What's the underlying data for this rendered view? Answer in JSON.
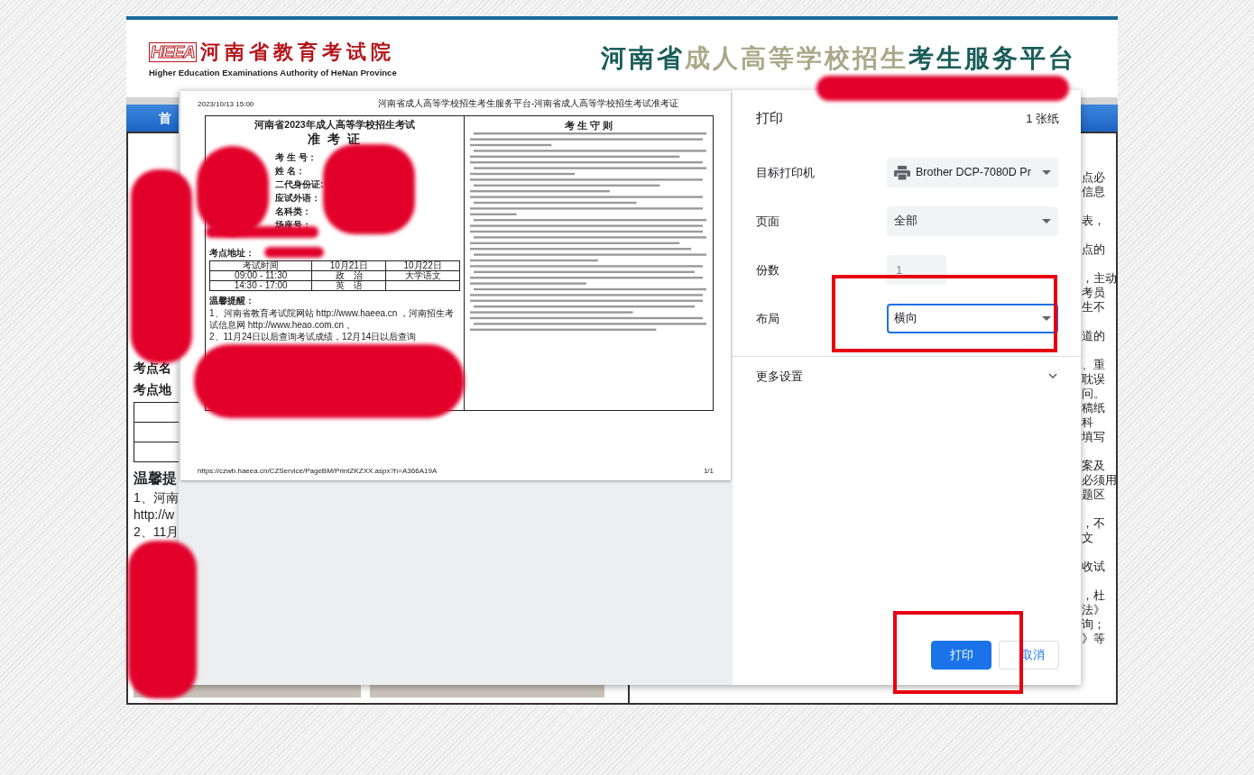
{
  "site_header": {
    "logo_mark": "HEEA",
    "org_name": "河南省教育考试院",
    "org_name_en": "Higher Education Examinations Authority of HeNan Province",
    "platform_title": [
      {
        "text": "河南省",
        "kind": "accent"
      },
      {
        "text": "成人高等学校招生",
        "kind": "muted"
      },
      {
        "text": "考生服务平台",
        "kind": "accent"
      }
    ]
  },
  "nav_items": [
    "首"
  ],
  "left_column": {
    "venue_name_label": "考点名",
    "venue_address_label": "考点地",
    "reminder_title": "温馨提",
    "reminder_lines": [
      "1、河南",
      "http://w",
      "2、11月"
    ]
  },
  "right_column_fragments": [
    [
      "点必",
      "信息"
    ],
    [
      "表，"
    ],
    [
      "点的"
    ],
    [
      "，主动",
      "考员",
      "生不"
    ],
    [
      "道的"
    ],
    [
      "、重",
      "耽误",
      "问。",
      "稿纸",
      "科",
      "填写"
    ],
    [
      "案及",
      "必须用",
      "题区"
    ],
    [
      "，不",
      "文"
    ],
    [
      "收试"
    ],
    [
      "，杜",
      "法》",
      "询；",
      "》等"
    ]
  ],
  "preview": {
    "print_date": "2023/10/13 15:00",
    "page_title": "河南省成人高等学校招生考生服务平台-河南省成人高等学校招生考试准考证",
    "exam_title": "河南省2023年成人高等学校招生考试",
    "card_title": "准 考 证",
    "info_labels": [
      "考 生 号：",
      "姓 名：",
      "二代身份证:",
      "应试外语：",
      "名科类：",
      "场座号："
    ],
    "address_label": "考点地址：",
    "schedule": {
      "columns": [
        "考试时间",
        "10月21日",
        "10月22日"
      ],
      "rows": [
        [
          "09:00 - 11:30",
          "政　治",
          "大学语文"
        ],
        [
          "14:30 - 17:00",
          "英　语"
        ]
      ]
    },
    "reminder_title": "温馨提醒：",
    "reminders": [
      "1、河南省教育考试院网站 http://www.haeea.cn ，河南招生考试信息网 http://www.heao.com.cn 。",
      "2、11月24日以后查询考试成绩，12月14日以后查询"
    ],
    "rules_title": "考 生 守 则",
    "footer_url": "https://czwb.haeea.cn/CZService/PageBM/PrintZKZXX.aspx?h=A366A19A",
    "page_number": "1/1"
  },
  "print_dialog": {
    "title": "打印",
    "sheet_count": "1 张纸",
    "fields": [
      {
        "label": "目标打印机",
        "kind": "printer",
        "value": "Brother DCP-7080D Pr",
        "focused": false,
        "disabled": false
      },
      {
        "label": "页面",
        "kind": "select",
        "value": "全部",
        "focused": false,
        "disabled": false
      },
      {
        "label": "份数",
        "kind": "number",
        "value": "1",
        "focused": false,
        "disabled": true
      },
      {
        "label": "布局",
        "kind": "select",
        "value": "横向",
        "focused": true,
        "disabled": false
      }
    ],
    "more_settings": {
      "label": "更多设置",
      "expanded": false
    },
    "buttons": [
      {
        "label": "打印",
        "kind": "primary"
      },
      {
        "label": "取消",
        "kind": "secondary"
      }
    ]
  }
}
